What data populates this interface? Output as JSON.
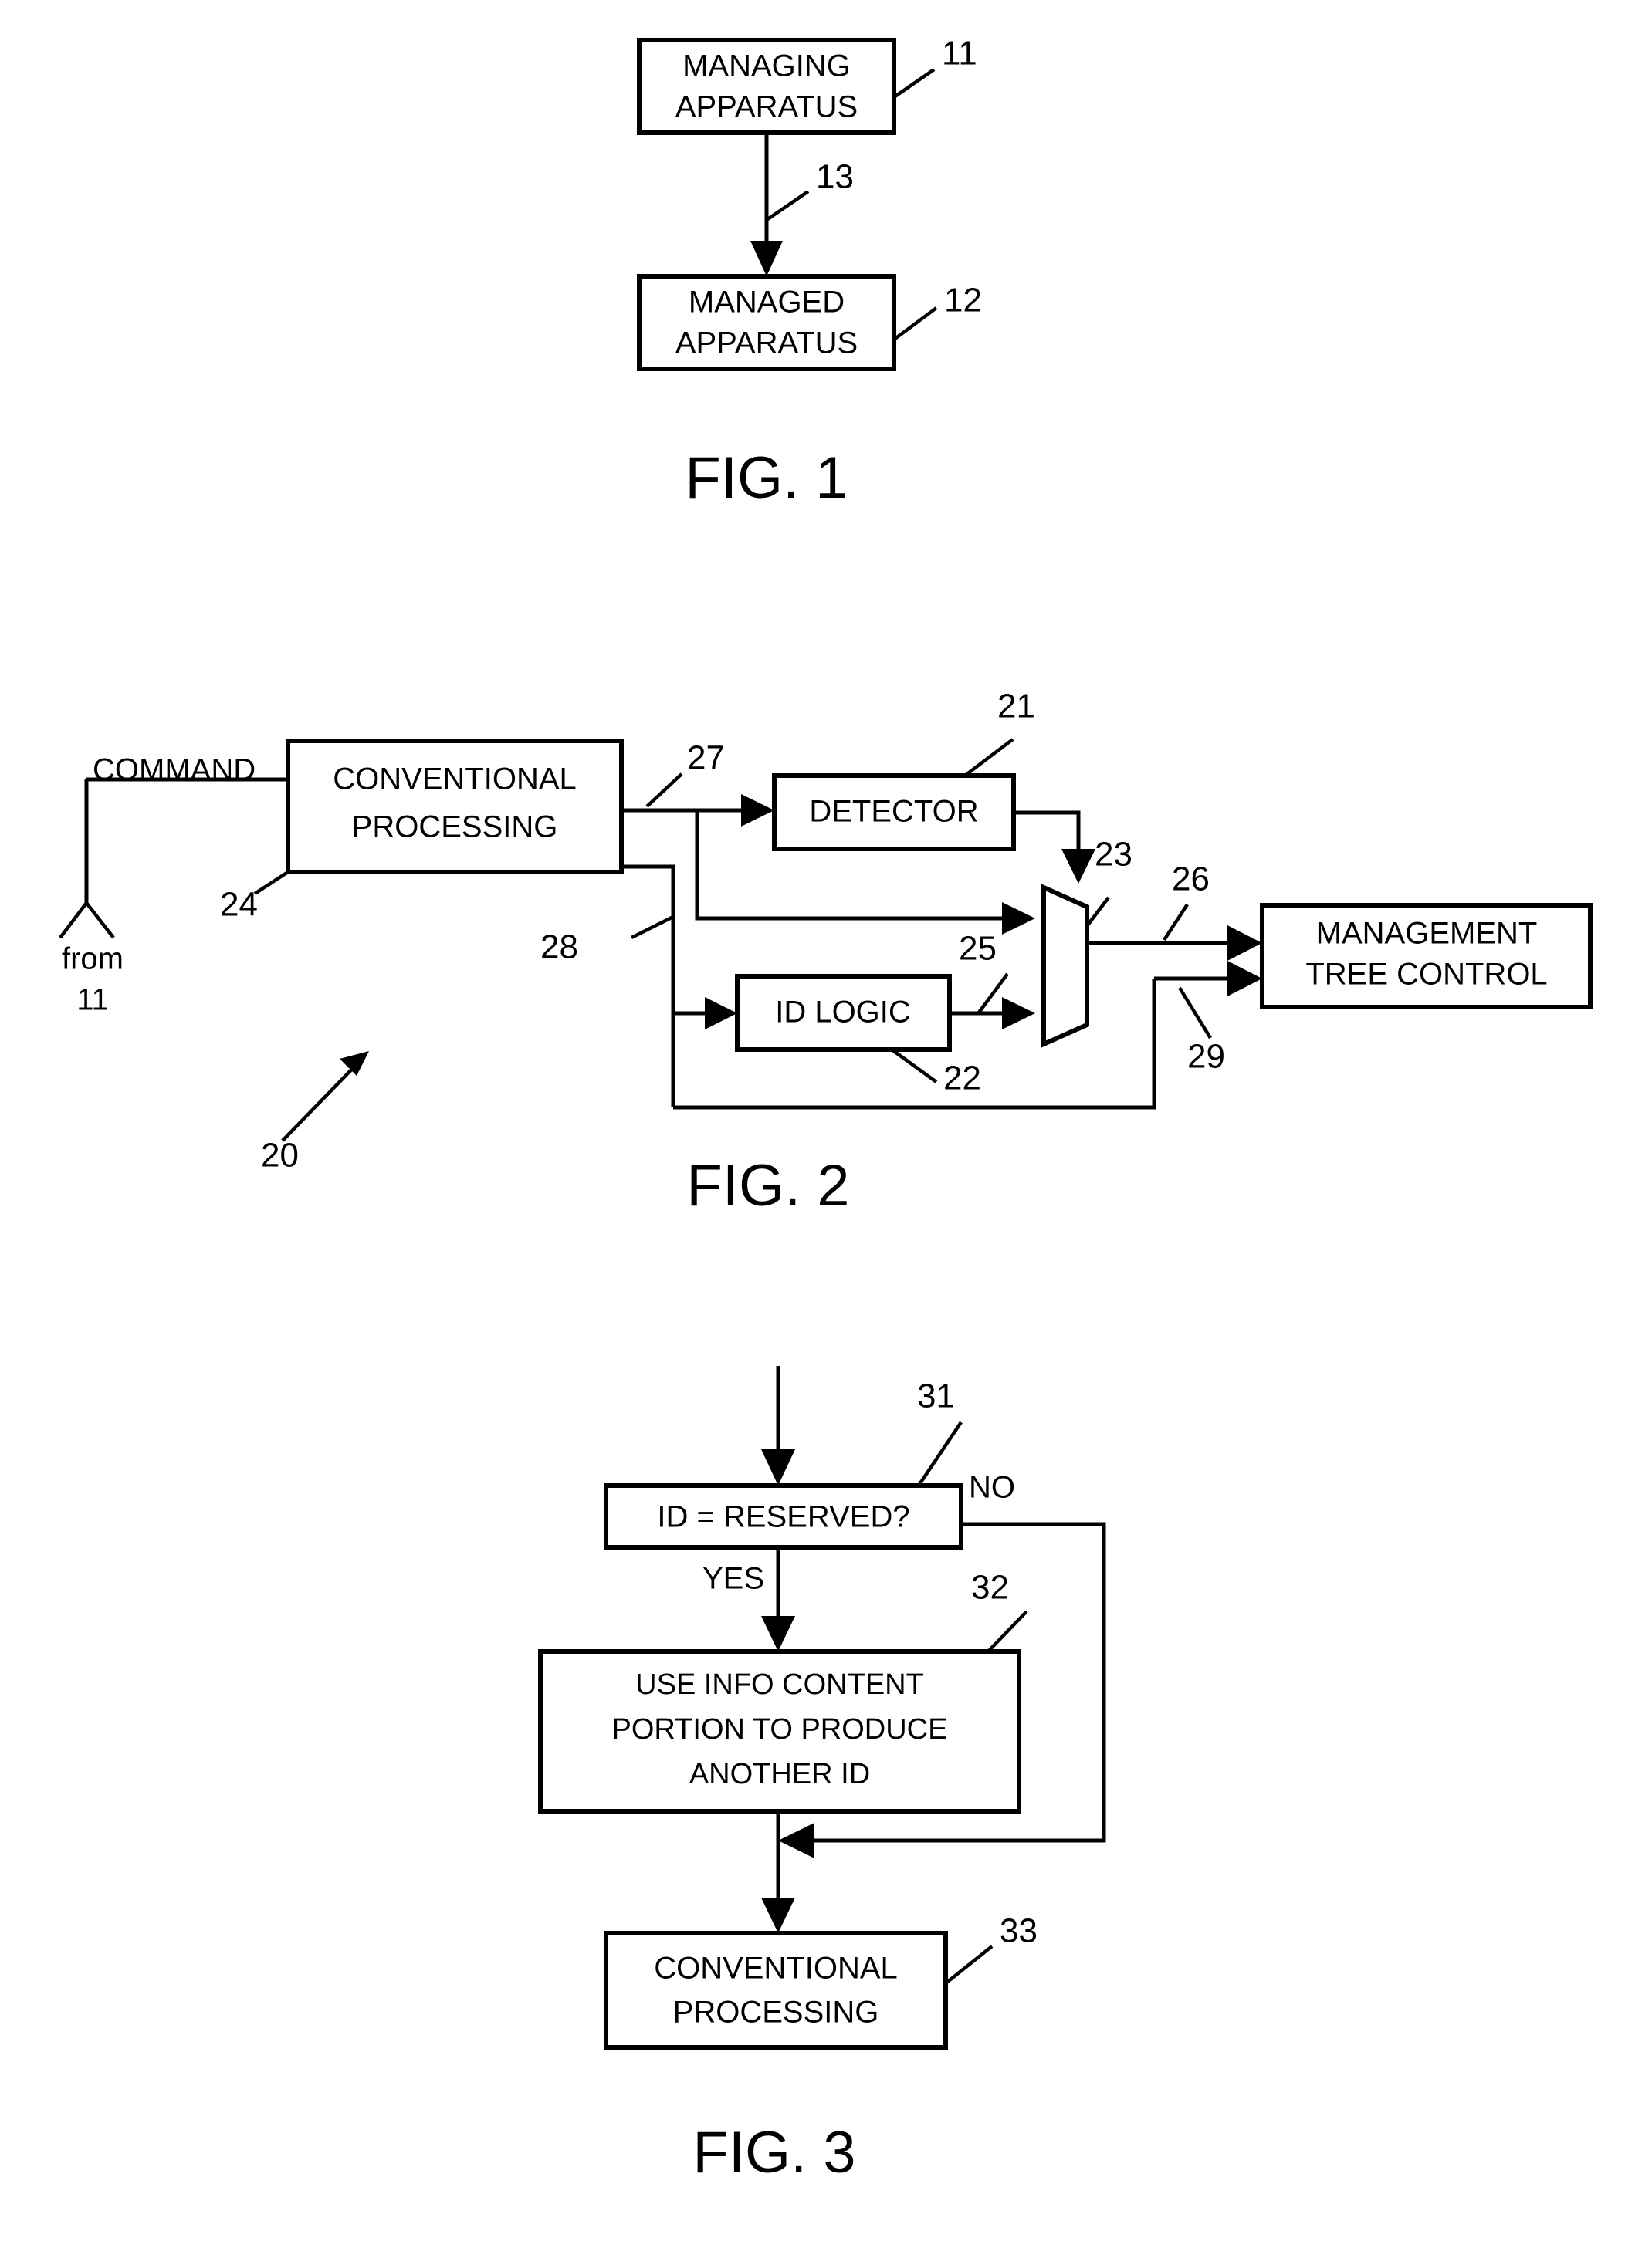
{
  "document": {
    "kind": "patent-drawing-sheet",
    "figures": [
      {
        "id": "fig1",
        "caption": "FIG. 1",
        "boxes": [
          {
            "id": "managing-apparatus",
            "line1": "MANAGING",
            "line2": "APPARATUS",
            "ref": "11"
          },
          {
            "id": "managed-apparatus",
            "line1": "MANAGED",
            "line2": "APPARATUS",
            "ref": "12"
          }
        ],
        "connectors": [
          {
            "id": "link-11-to-12",
            "ref": "13"
          }
        ]
      },
      {
        "id": "fig2",
        "caption": "FIG. 2",
        "system_ref": "20",
        "source_label_line1": "from",
        "source_label_line2": "11",
        "input_label": "COMMAND",
        "boxes": [
          {
            "id": "conventional-processing",
            "line1": "CONVENTIONAL",
            "line2": "PROCESSING",
            "ref": "24"
          },
          {
            "id": "detector",
            "line1": "DETECTOR",
            "line2": "",
            "ref": "21"
          },
          {
            "id": "id-logic",
            "line1": "ID LOGIC",
            "line2": "",
            "ref": "22"
          },
          {
            "id": "management-tree-control",
            "line1": "MANAGEMENT",
            "line2": "TREE CONTROL",
            "ref": ""
          }
        ],
        "mux": {
          "id": "selector",
          "ref": "23"
        },
        "signal_refs": [
          {
            "id": "sig-27",
            "ref": "27"
          },
          {
            "id": "sig-28",
            "ref": "28"
          },
          {
            "id": "sig-25",
            "ref": "25"
          },
          {
            "id": "sig-26",
            "ref": "26"
          },
          {
            "id": "sig-29",
            "ref": "29"
          }
        ]
      },
      {
        "id": "fig3",
        "caption": "FIG. 3",
        "boxes": [
          {
            "id": "decision-id-reserved",
            "line1": "ID = RESERVED?",
            "line2": "",
            "line3": "",
            "ref": "31"
          },
          {
            "id": "use-info-content",
            "line1": "USE INFO CONTENT",
            "line2": "PORTION TO PRODUCE",
            "line3": "ANOTHER ID",
            "ref": "32"
          },
          {
            "id": "conventional-processing",
            "line1": "CONVENTIONAL",
            "line2": "PROCESSING",
            "line3": "",
            "ref": "33"
          }
        ],
        "branch_labels": [
          {
            "id": "branch-no",
            "text": "NO"
          },
          {
            "id": "branch-yes",
            "text": "YES"
          }
        ]
      }
    ]
  },
  "colors": {
    "ink": "#000000",
    "paper": "#ffffff"
  }
}
